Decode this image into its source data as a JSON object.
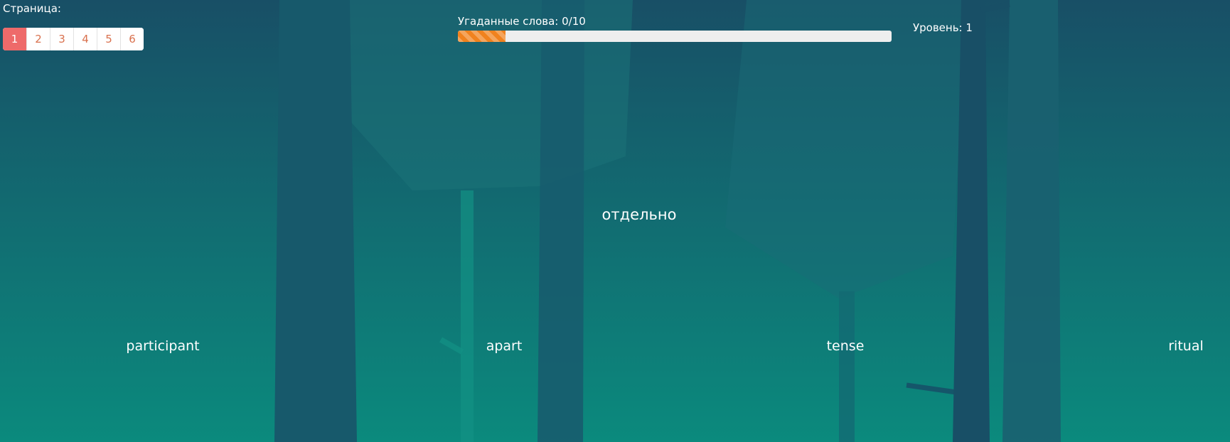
{
  "pagination": {
    "label": "Страница:",
    "pages": [
      "1",
      "2",
      "3",
      "4",
      "5",
      "6"
    ],
    "active": "1"
  },
  "progress": {
    "label": "Угаданные слова: 0/10",
    "fraction": 0.11
  },
  "level": {
    "label": "Уровень: 1"
  },
  "question": {
    "word": "отдельно"
  },
  "options": [
    "participant",
    "apart",
    "tense",
    "ritual"
  ],
  "colors": {
    "background_top": "#184f66",
    "background_bottom": "#0b8a7d",
    "active_page": "#ee6a6a",
    "page_text": "#d9714e",
    "progress_fill": "#f0821e"
  }
}
